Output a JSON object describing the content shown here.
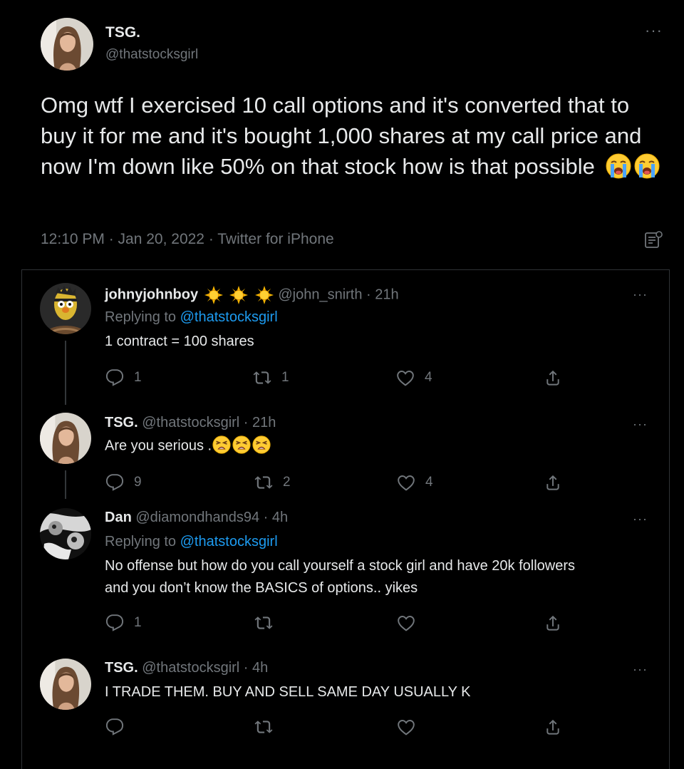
{
  "main_tweet": {
    "display_name": "TSG.",
    "handle": "@thatstocksgirl",
    "text": "Omg wtf I exercised 10 call options and it's converted that to buy it for me and it's bought 1,000 shares at my call price and now I'm down like 50% on that stock how is that possible",
    "emojis": [
      "loudly-crying-face",
      "loudly-crying-face"
    ],
    "timestamp": "12:10 PM · Jan 20, 2022 · Twitter for iPhone"
  },
  "replies": [
    {
      "display_name": "johnyjohnboy",
      "name_emojis": [
        "sun-emoji",
        "sun-emoji",
        "sun-emoji"
      ],
      "handle_time": "@john_snirth · 21h",
      "replying_prefix": "Replying to",
      "replying_handle": "@thatstocksgirl",
      "text": "1 contract = 100 shares",
      "reply_count": "1",
      "retweet_count": "1",
      "like_count": "4"
    },
    {
      "display_name": "TSG.",
      "handle_time": "@thatstocksgirl · 21h",
      "text": "Are you serious .",
      "emojis": [
        "tired-face",
        "tired-face",
        "tired-face"
      ],
      "reply_count": "9",
      "retweet_count": "2",
      "like_count": "4"
    },
    {
      "display_name": "Dan",
      "handle_time": "@diamondhands94 · 4h",
      "replying_prefix": "Replying to",
      "replying_handle": "@thatstocksgirl",
      "text_line1": "No offense but how do you call yourself a stock girl and have 20k followers",
      "text_line2": "and you don’t know the BASICS of options.. yikes",
      "reply_count": "1",
      "retweet_count": "",
      "like_count": ""
    },
    {
      "display_name": "TSG.",
      "handle_time": "@thatstocksgirl · 4h",
      "text": "I TRADE THEM. BUY AND SELL SAME DAY USUALLY K",
      "reply_count": "",
      "retweet_count": "",
      "like_count": ""
    }
  ],
  "colors": {
    "background": "#000000",
    "text": "#e7e9ea",
    "muted": "#71767b",
    "link": "#1d9bf0"
  }
}
